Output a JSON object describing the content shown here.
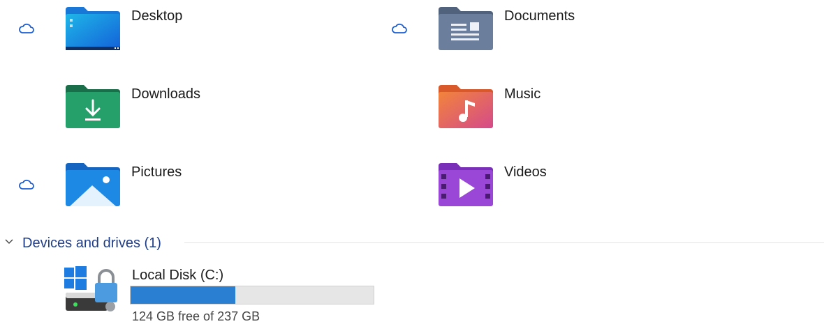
{
  "folders": [
    {
      "name": "Desktop",
      "icon": "desktop-folder-icon",
      "cloud": true
    },
    {
      "name": "Documents",
      "icon": "documents-folder-icon",
      "cloud": true
    },
    {
      "name": "Downloads",
      "icon": "downloads-folder-icon",
      "cloud": false
    },
    {
      "name": "Music",
      "icon": "music-folder-icon",
      "cloud": false
    },
    {
      "name": "Pictures",
      "icon": "pictures-folder-icon",
      "cloud": true
    },
    {
      "name": "Videos",
      "icon": "videos-folder-icon",
      "cloud": false
    }
  ],
  "devices": {
    "title": "Devices and drives (1)",
    "drives": [
      {
        "name": "Local Disk (C:)",
        "usage_text": "124 GB free of 237 GB",
        "used_fraction": 0.43
      }
    ]
  },
  "colors": {
    "cloud": "#1a5fd6",
    "section_title": "#1f3e8a",
    "bar_fill": "#2b7fd2",
    "bar_track": "#e6e6e6"
  }
}
